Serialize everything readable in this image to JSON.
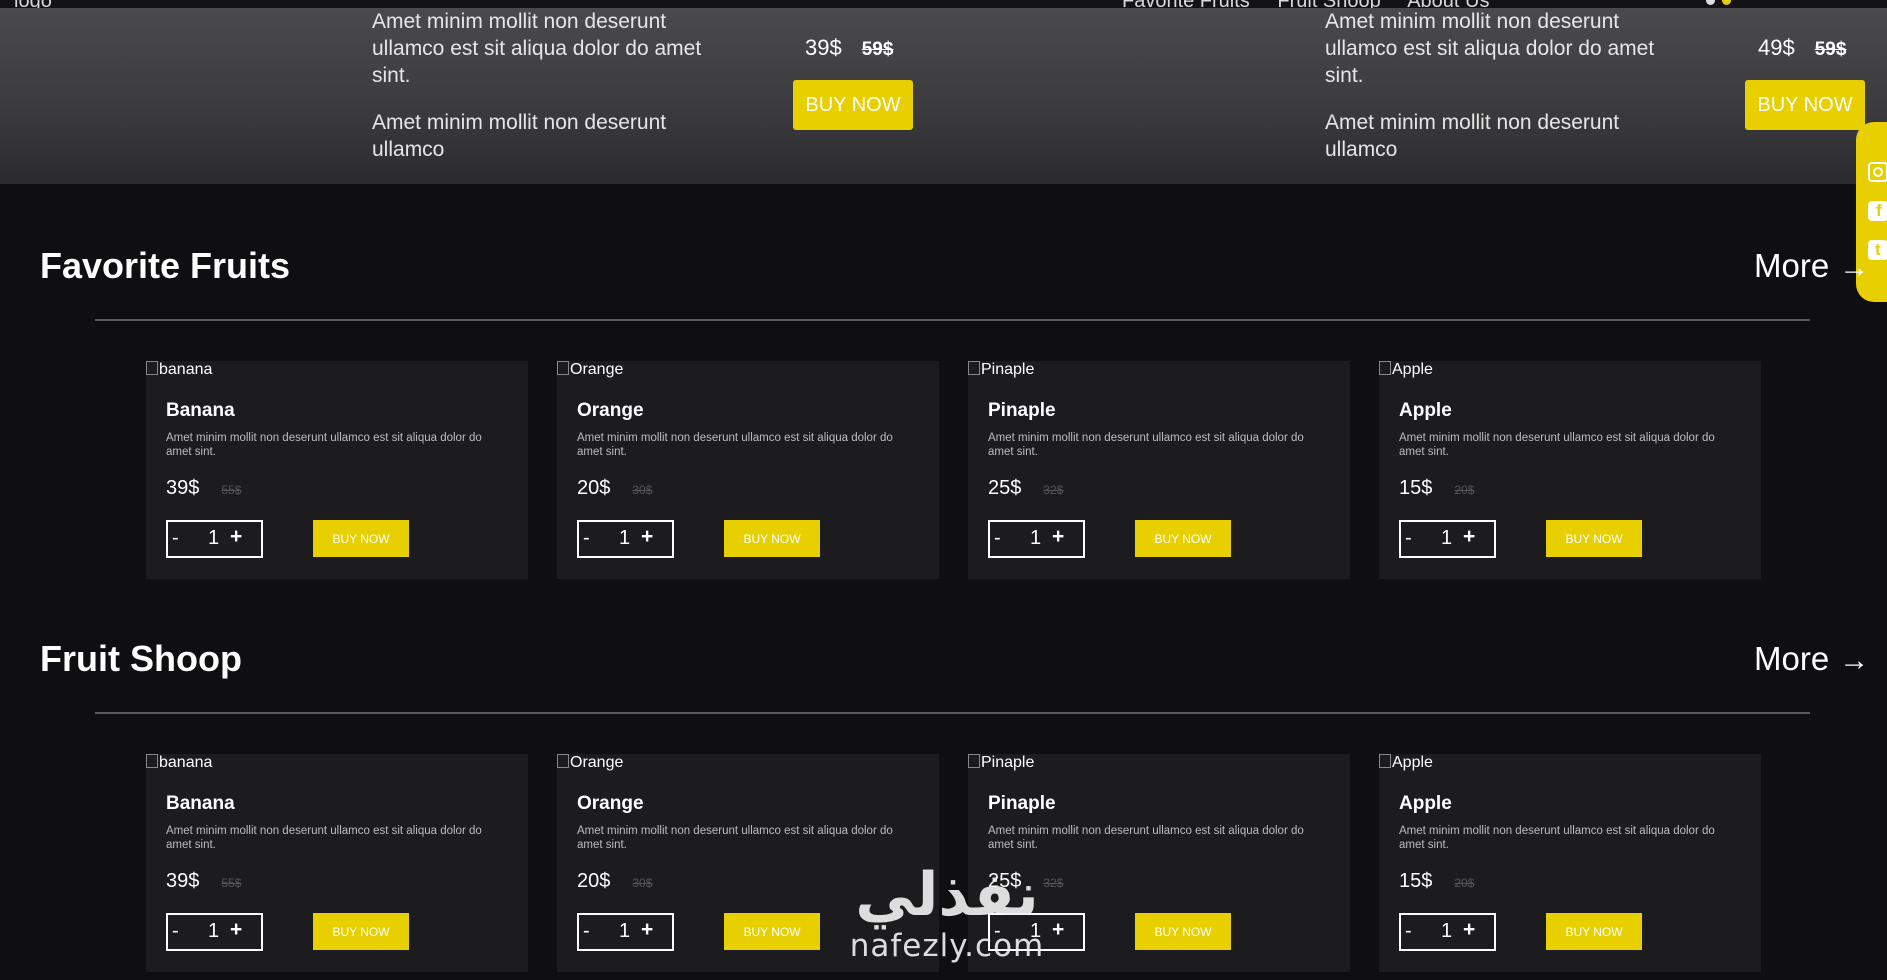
{
  "nav": {
    "logo": "logo",
    "links": [
      "Favorite Fruits",
      "Fruit Shoop",
      "About Us"
    ]
  },
  "hero": {
    "items": [
      {
        "text_1": "Amet minim mollit non deserunt ullamco est sit aliqua dolor do amet sint.",
        "text_2": "Amet minim mollit non deserunt ullamco",
        "price": "39$",
        "old_price": "59$",
        "button": "BUY NOW"
      },
      {
        "text_1": "Amet minim mollit non deserunt ullamco est sit aliqua dolor do amet sint.",
        "text_2": "Amet minim mollit non deserunt ullamco",
        "price": "49$",
        "old_price": "59$",
        "button": "BUY NOW"
      }
    ]
  },
  "social": [
    "instagram-icon",
    "facebook-icon",
    "twitter-icon"
  ],
  "sections": [
    {
      "title": "Favorite Fruits",
      "more": "More",
      "cards": [
        {
          "alt": "banana",
          "name": "Banana",
          "desc": "Amet minim mollit non deserunt ullamco est sit aliqua dolor do amet sint.",
          "price": "39$",
          "old_price": "55$",
          "qty": "1",
          "minus": "-",
          "plus": "+",
          "button": "BUY NOW"
        },
        {
          "alt": "Orange",
          "name": "Orange",
          "desc": "Amet minim mollit non deserunt ullamco est sit aliqua dolor do amet sint.",
          "price": "20$",
          "old_price": "30$",
          "qty": "1",
          "minus": "-",
          "plus": "+",
          "button": "BUY NOW"
        },
        {
          "alt": "Pinaple",
          "name": "Pinaple",
          "desc": "Amet minim mollit non deserunt ullamco est sit aliqua dolor do amet sint.",
          "price": "25$",
          "old_price": "32$",
          "qty": "1",
          "minus": "-",
          "plus": "+",
          "button": "BUY NOW"
        },
        {
          "alt": "Apple",
          "name": "Apple",
          "desc": "Amet minim mollit non deserunt ullamco est sit aliqua dolor do amet sint.",
          "price": "15$",
          "old_price": "20$",
          "qty": "1",
          "minus": "-",
          "plus": "+",
          "button": "BUY NOW"
        }
      ]
    },
    {
      "title": "Fruit Shoop",
      "more": "More",
      "cards": [
        {
          "alt": "banana",
          "name": "Banana",
          "desc": "Amet minim mollit non deserunt ullamco est sit aliqua dolor do amet sint.",
          "price": "39$",
          "old_price": "55$",
          "qty": "1",
          "minus": "-",
          "plus": "+",
          "button": "BUY NOW"
        },
        {
          "alt": "Orange",
          "name": "Orange",
          "desc": "Amet minim mollit non deserunt ullamco est sit aliqua dolor do amet sint.",
          "price": "20$",
          "old_price": "30$",
          "qty": "1",
          "minus": "-",
          "plus": "+",
          "button": "BUY NOW"
        },
        {
          "alt": "Pinaple",
          "name": "Pinaple",
          "desc": "Amet minim mollit non deserunt ullamco est sit aliqua dolor do amet sint.",
          "price": "25$",
          "old_price": "32$",
          "qty": "1",
          "minus": "-",
          "plus": "+",
          "button": "BUY NOW"
        },
        {
          "alt": "Apple",
          "name": "Apple",
          "desc": "Amet minim mollit non deserunt ullamco est sit aliqua dolor do amet sint.",
          "price": "15$",
          "old_price": "20$",
          "qty": "1",
          "minus": "-",
          "plus": "+",
          "button": "BUY NOW"
        }
      ]
    }
  ],
  "watermark": {
    "arabic": "نفذلي",
    "latin": "nafezly.com"
  },
  "colors": {
    "accent": "#e8cf00",
    "background": "#0f0e10",
    "card": "#1c1b1e"
  }
}
